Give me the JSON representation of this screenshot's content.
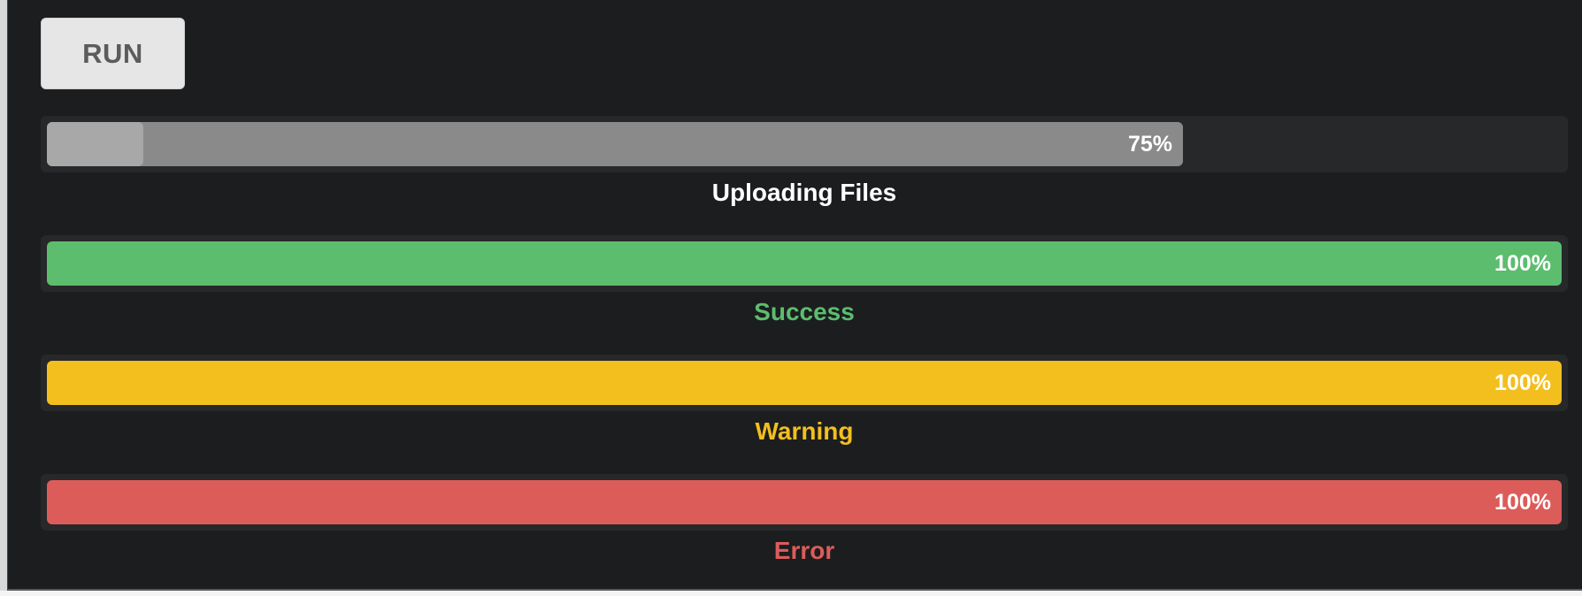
{
  "toolbar": {
    "run_label": "RUN"
  },
  "progress_bars": [
    {
      "id": "uploading",
      "percent_text": "75%",
      "value": 0.75,
      "caption": "Uploading Files",
      "fill_color": "#8a8a8a",
      "caption_color": "#ffffff"
    },
    {
      "id": "success",
      "percent_text": "100%",
      "value": 1.0,
      "caption": "Success",
      "fill_color": "#5cbd6f",
      "caption_color": "#5cbd6f"
    },
    {
      "id": "warning",
      "percent_text": "100%",
      "value": 1.0,
      "caption": "Warning",
      "fill_color": "#f2bf1f",
      "caption_color": "#f2bf1f"
    },
    {
      "id": "error",
      "percent_text": "100%",
      "value": 1.0,
      "caption": "Error",
      "fill_color": "#dc5c5a",
      "caption_color": "#dc5c5a"
    }
  ]
}
